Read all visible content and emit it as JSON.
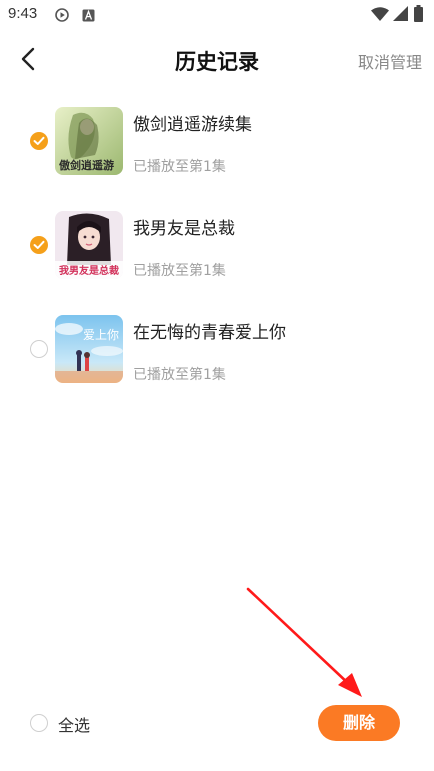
{
  "status_bar": {
    "time": "9:43",
    "icons": [
      "play-circle-icon",
      "a-badge-icon",
      "wifi-icon",
      "signal-icon",
      "battery-icon"
    ]
  },
  "header": {
    "title": "历史记录",
    "back_icon": "chevron-left-icon",
    "cancel_label": "取消管理"
  },
  "items": [
    {
      "title": "傲剑逍遥游续集",
      "progress": "已播放至第1集",
      "checked": true,
      "cover_text": "傲剑逍遥游"
    },
    {
      "title": "我男友是总裁",
      "progress": "已播放至第1集",
      "checked": true,
      "cover_text": "我男友是总裁"
    },
    {
      "title": "在无悔的青春爱上你",
      "progress": "已播放至第1集",
      "checked": false,
      "cover_text": "爱上你"
    }
  ],
  "footer": {
    "select_all_label": "全选",
    "delete_label": "删除"
  },
  "colors": {
    "accent_orange": "#f5a01a",
    "delete_button": "#fb7a24",
    "annotation_arrow": "#ff1a1a"
  }
}
